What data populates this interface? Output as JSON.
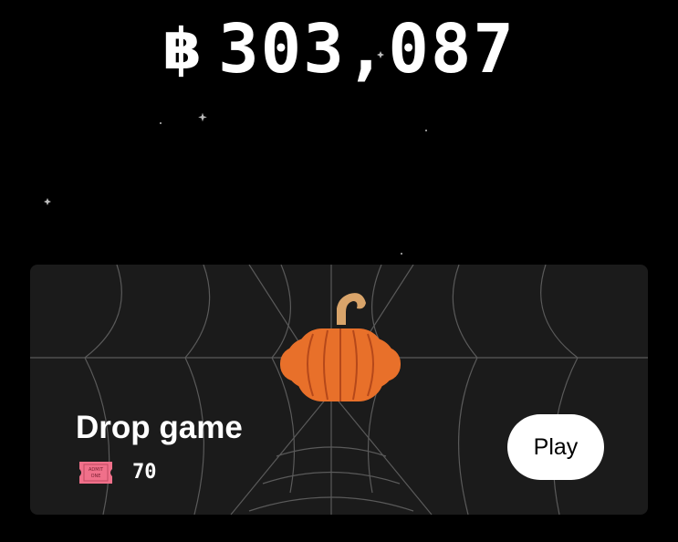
{
  "balance": {
    "currency_symbol": "฿",
    "amount": "303,087"
  },
  "game_card": {
    "title": "Drop game",
    "ticket_icon_text": [
      "ADMIT",
      "ONE"
    ],
    "cost": "70",
    "play_label": "Play"
  },
  "colors": {
    "background": "#000000",
    "card": "#1b1b1b",
    "pumpkin": "#e8702a",
    "ticket": "#f0708a",
    "button": "#ffffff"
  },
  "icons": {
    "balance": "baht-coin-icon",
    "ticket": "ticket-icon",
    "illustration": "pumpkin-icon"
  }
}
